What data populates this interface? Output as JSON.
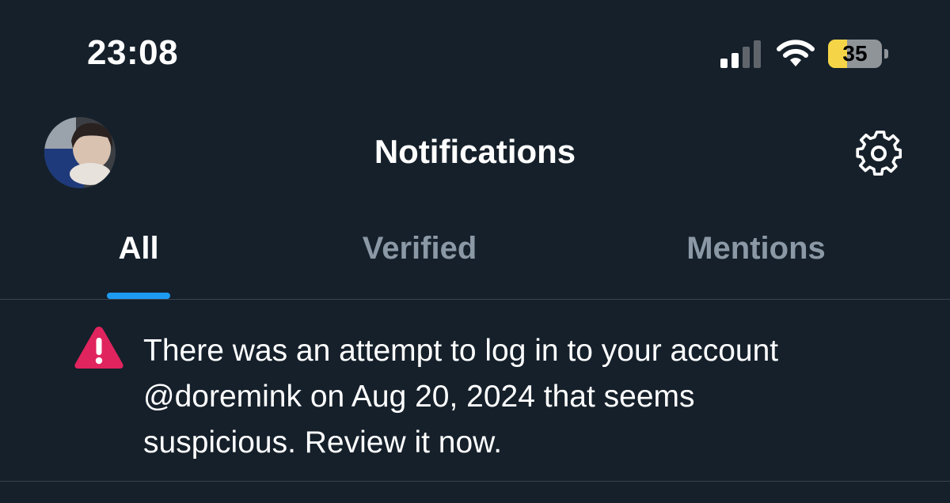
{
  "status_bar": {
    "time": "23:08",
    "battery": "35",
    "battery_fill_percent": 35,
    "battery_fill_color": "#f5d547",
    "signal_icon": "cellular-signal-icon",
    "wifi_icon": "wifi-icon"
  },
  "header": {
    "title": "Notifications",
    "avatar_icon": "profile-avatar",
    "settings_icon": "gear-icon"
  },
  "tabs": [
    {
      "label": "All",
      "active": true
    },
    {
      "label": "Verified",
      "active": false
    },
    {
      "label": "Mentions",
      "active": false
    }
  ],
  "notifications": [
    {
      "icon": "warning-icon",
      "lines": [
        "There was an attempt to log in to your account",
        "@doremink on Aug 20, 2024 that seems",
        "suspicious. Review it now."
      ]
    }
  ],
  "colors": {
    "background": "#15202b",
    "accent": "#1d9bf0",
    "warning": "#e0245e",
    "inactive_tab": "#8b98a5",
    "divider": "#38444d"
  }
}
